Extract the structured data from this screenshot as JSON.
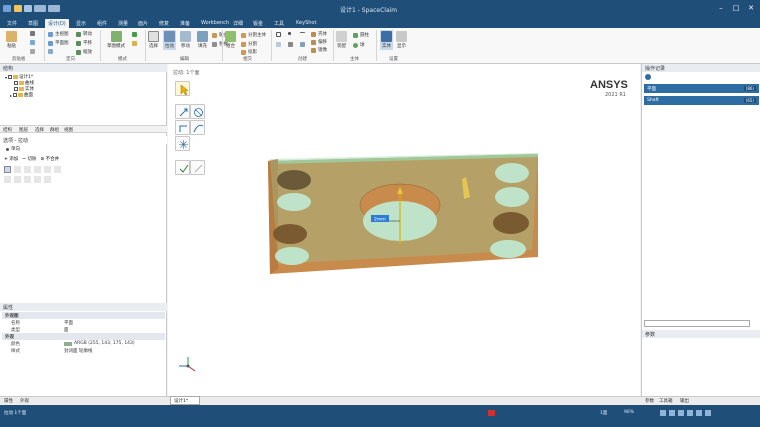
{
  "window": {
    "title": "设计1 - SpaceClaim"
  },
  "menu_tabs": [
    "文件",
    "草图",
    "设计(D)",
    "显示",
    "组件",
    "测量",
    "面片",
    "修复",
    "准备",
    "Workbench",
    "详细",
    "钣金",
    "工具",
    "KeyShot"
  ],
  "active_tab_index": 2,
  "ribbon": {
    "clipboard": {
      "paste_label": "粘贴",
      "group": "剪贴板"
    },
    "orient": {
      "home_label": "主视图",
      "plane_label": "平面图",
      "spin_label": "转动",
      "pan_label": "平移",
      "zoom_label": "缩放",
      "group": "定向"
    },
    "mode": {
      "sketch_mode_label": "草图模式",
      "group": "模式"
    },
    "edit": {
      "select_label": "选择",
      "pull_label": "拉动",
      "move_label": "移动",
      "fill_label": "填充",
      "blend_label": "融合",
      "replace_label": "替换",
      "group": "编辑"
    },
    "intersect": {
      "combine_label": "组合",
      "split_body_label": "分割主体",
      "split_label": "分割",
      "project_label": "投影",
      "group": "相交"
    },
    "create": {
      "shell_label": "壳体",
      "offset_label": "偏移",
      "mirror_label": "镜像",
      "group": "创建"
    },
    "body": {
      "cylinder_label": "圆柱",
      "sphere_label": "球",
      "assembly_label": "装配",
      "group": "主体"
    },
    "settings": {
      "body_label": "实体",
      "display_label": "显示",
      "group": "设置"
    }
  },
  "left_pane": {
    "structure_header": "结构",
    "tree": [
      {
        "label": "设计1*",
        "level": 0
      },
      {
        "label": "曲线",
        "level": 1
      },
      {
        "label": "实体",
        "level": 1
      },
      {
        "label": "曲面",
        "level": 1
      }
    ],
    "tabs": [
      "结构",
      "图层",
      "选择",
      "群组",
      "视图"
    ],
    "options_header": "选项 - 拉动",
    "option_mode": "单向",
    "option_labels": [
      "添加",
      "切除",
      "不合并"
    ],
    "props_header": "属性",
    "props": [
      {
        "section": "外观图"
      },
      {
        "key": "名称",
        "value": "平面"
      },
      {
        "key": "类型",
        "value": "面"
      },
      {
        "section": "外观"
      },
      {
        "key": "颜色",
        "value": "ARGB (255, 143, 175, 143)"
      },
      {
        "key": "样式",
        "value": "封闭面 轮廓线"
      }
    ]
  },
  "canvas": {
    "breadcrumb": "拉动: 1个面",
    "brand": "ANSYS",
    "version": "2021 R1",
    "dimension_value": "2mm",
    "bottom_tab": "设计1*"
  },
  "right_pane": {
    "header": "操作记录",
    "items": [
      {
        "label": "平面",
        "badge": "(86)"
      },
      {
        "label": "Shaft",
        "badge": "(65)"
      }
    ],
    "params_header": "参数"
  },
  "bottom_tabs_left": [
    "属性",
    "外观"
  ],
  "bottom_tabs_right": [
    "参数",
    "工具箱",
    "输出"
  ],
  "status": {
    "left": "拉动 1个面",
    "center": "1面",
    "zoom": "96%"
  },
  "colors": {
    "title_bar": "#1f4e79",
    "part_top": "#8fc99e",
    "part_side": "#c98b4b",
    "selection": "#e8c43a",
    "history_item": "#2e6da4"
  }
}
